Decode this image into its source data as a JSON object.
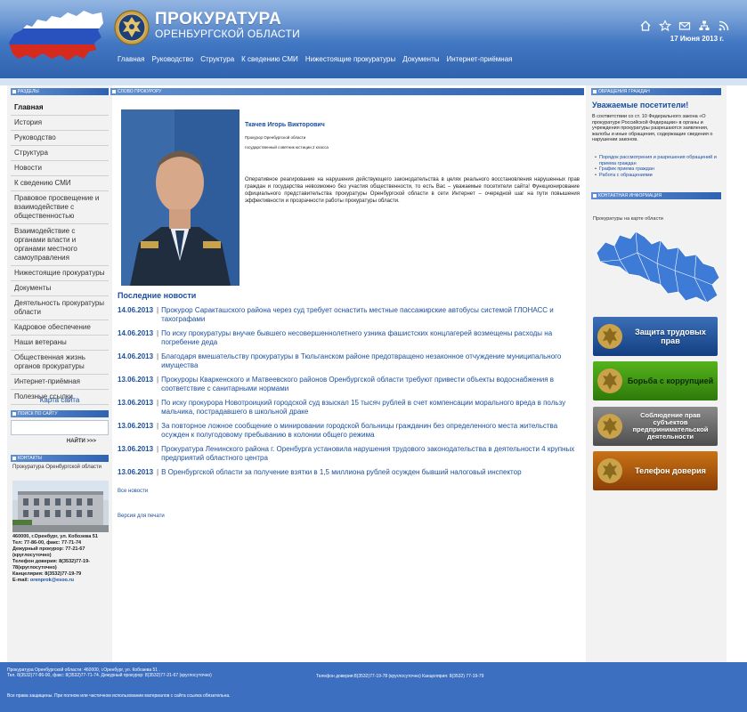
{
  "header": {
    "title": "ПРОКУРАТУРА",
    "subtitle": "ОРЕНБУРГСКОЙ ОБЛАСТИ",
    "date": "17 Июня 2013 г.",
    "icons": [
      "home-icon",
      "star-icon",
      "mail-icon",
      "sitemap-icon",
      "rss-icon"
    ],
    "nav": [
      "Главная",
      "Руководство",
      "Структура",
      "К сведению СМИ",
      "Нижестоящие прокуратуры",
      "Документы",
      "Интернет-приёмная"
    ]
  },
  "sections": {
    "left": "РАЗДЕЛЫ",
    "center": "СЛОВО ПРОКУРОРУ",
    "right": "ОБРАЩЕНИЯ ГРАЖДАН",
    "search": "ПОИСК ПО САЙТУ",
    "contacts": "КОНТАКТЫ",
    "contact_info": "КОНТАКТНАЯ ИНФОРМАЦИЯ"
  },
  "menu": [
    "Главная",
    "История",
    "Руководство",
    "Структура",
    "Новости",
    "К сведению СМИ",
    "Правовое просвещение и взаимодействие с общественностью",
    "Взаимодействие с органами власти и органами местного самоуправления",
    "Нижестоящие прокуратуры",
    "Документы",
    "Деятельность прокуратуры области",
    "Кадровое обеспечение",
    "Наши ветераны",
    "Общественная жизнь органов прокуратуры",
    "Интернет-приёмная",
    "Полезные ссылки"
  ],
  "sitemap": "Карта сайта",
  "search": {
    "placeholder": "",
    "button": "НАЙТИ >>>"
  },
  "contacts": {
    "title": "Прокуратура Оренбургской области",
    "address": "460000, г.Оренбург, ул. Кобозева 51",
    "phones": "Тел: 77-86-00, факс: 77-71-74",
    "duty": "Дежурный прокурор: 77-21-67 (круглосуточно)",
    "trust": "Телефон доверия: 8(3532)77-19-78(круглосуточно)",
    "office": "Канцелярия: 8(3532)77-19-79",
    "email_label": "E-mail:",
    "email": "orenprok@esoo.ru"
  },
  "prosecutor": {
    "name": "Ткачев Игорь Викторович",
    "post": "Прокурор Оренбургской области",
    "rank": "государственный советник юстиции 2 класса",
    "text": "Оперативное реагирование на нарушения действующего законодательства в целях реального восстановления нарушенных прав граждан и государства невозможно без участия общественности, то есть Вас – уважаемые посетители сайта! Функционирование официального представительства прокуратуры Оренбургской области в сети Интернет – очередной шаг на пути повышения эффективности и прозрачности работы прокуратуры области."
  },
  "news_title": "Последние новости",
  "news": [
    {
      "date": "14.06.2013",
      "text": "Прокурор Саракташского района через суд требует оснастить местные пассажирские автобусы системой ГЛОНАСС и тахографами"
    },
    {
      "date": "14.06.2013",
      "text": "По иску прокуратуры внучке бывшего несовершеннолетнего узника фашистских концлагерей возмещены расходы на погребение деда"
    },
    {
      "date": "14.06.2013",
      "text": "Благодаря вмешательству прокуратуры в Тюльганском районе предотвращено незаконное отчуждение муниципального имущества"
    },
    {
      "date": "13.06.2013",
      "text": "Прокуроры Кваркенского и Матвеевского районов Оренбургской области требуют привести объекты водоснабжения в соответствие с санитарными нормами"
    },
    {
      "date": "13.06.2013",
      "text": "По иску прокурора Новотроицкий городской суд взыскал 15 тысяч рублей в счет компенсации морального вреда в пользу мальчика, пострадавшего в школьной драке"
    },
    {
      "date": "13.06.2013",
      "text": "За повторное ложное сообщение о минировании городской больницы гражданин без определенного места жительства осужден к полугодовому пребыванию в колонии общего режима"
    },
    {
      "date": "13.06.2013",
      "text": "Прокуратура Ленинского района г. Оренбурга установила нарушения трудового законодательства в деятельности 4 крупных предприятий областного центра"
    },
    {
      "date": "13.06.2013",
      "text": "В Оренбургской области за получение взятки в 1,5 миллиона рублей осужден бывший налоговый инспектор"
    }
  ],
  "all_news": "Все новости",
  "print_version": "Версия для печати",
  "right": {
    "welcome": "Уважаемые посетители!",
    "welcome_text": "В соответствии со ст. 10 Федерального закона «О прокуратуре Российской Федерации» в органы и учреждения прокуратуры разрешаются заявления, жалобы и иные обращения, содержащие сведения о нарушении законов.",
    "links": [
      "Порядок рассмотрения и разрешения обращений и приема граждан",
      "График приема граждан",
      "Работа с обращениями"
    ],
    "map_caption": "Прокуратуры на карте области",
    "banners": [
      "Защита трудовых прав",
      "Борьба с коррупцией",
      "Соблюдение прав субъектов предпринимательской деятельности",
      "Телефон доверия"
    ]
  },
  "footer": {
    "line1": "Прокуратура Оренбургской области: 460000, г.Оренбург, ул. Кобозева 51 .",
    "line1b": "Тел. 8(3532)77-86-00, факс: 8(3532)77-71-74. Дежурный прокурор: 8(3532)77-21-67 (круглосуточно)",
    "line2": "Телефон доверия:8(3532)77-19-78 (круглосуточно) Канцелярия: 8(3532) 77-19-79",
    "copyright": "Все права защищены. При полном или частичном использовании материалов с сайта ссылка обязательна."
  },
  "colors": {
    "header_blue": "#3f74c0",
    "link_blue": "#1a4fa0",
    "footer_blue": "#3c6fc0"
  }
}
